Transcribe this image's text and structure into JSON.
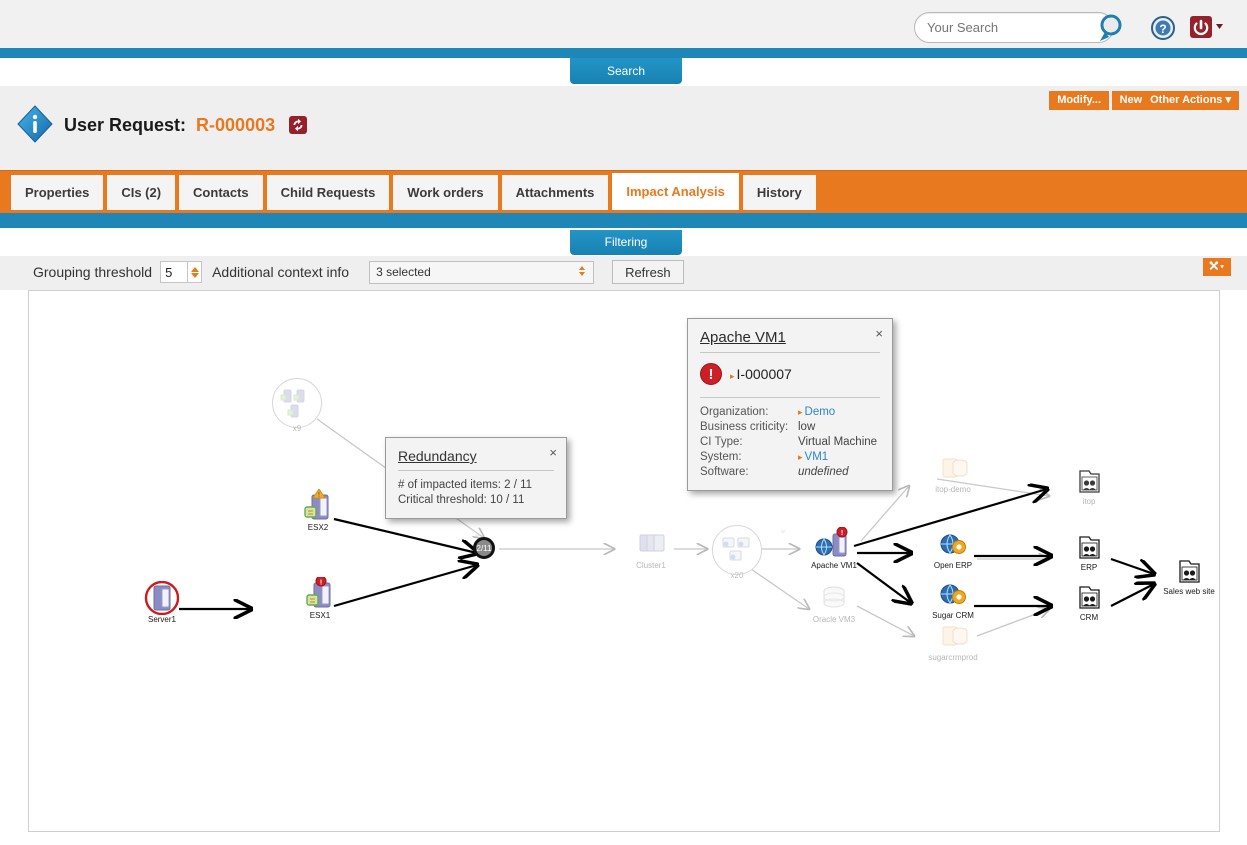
{
  "topbar": {
    "search_placeholder": "Your Search",
    "search_value": "",
    "search_icon": "magnifier-icon",
    "help_icon": "help-question-icon",
    "power_icon": "power-logout-icon"
  },
  "search_tab": {
    "label": "Search"
  },
  "actions": {
    "modify": "Modify...",
    "new": "New...",
    "other": "Other Actions"
  },
  "page": {
    "title_prefix": "User Request:",
    "title_code": "R-000003",
    "info_icon": "info-diamond-icon",
    "refresh_icon": "refresh-icon"
  },
  "tabs": [
    {
      "label": "Properties",
      "active": false
    },
    {
      "label": "CIs (2)",
      "active": false
    },
    {
      "label": "Contacts",
      "active": false
    },
    {
      "label": "Child Requests",
      "active": false
    },
    {
      "label": "Work orders",
      "active": false
    },
    {
      "label": "Attachments",
      "active": false
    },
    {
      "label": "Impact Analysis",
      "active": true
    },
    {
      "label": "History",
      "active": false
    }
  ],
  "filtering_tab": {
    "label": "Filtering"
  },
  "filters": {
    "grouping_label": "Grouping threshold",
    "grouping_value": "5",
    "context_label": "Additional context info",
    "context_value": "3 selected",
    "refresh_label": "Refresh",
    "tools_icon": "tools-wrench-icon"
  },
  "popups": {
    "apache": {
      "title": "Apache VM1",
      "close": "×",
      "ticket": "I-000007",
      "ticket_icon": "error-exclamation-icon",
      "fields": [
        {
          "key": "Organization:",
          "value": "Demo",
          "link": true
        },
        {
          "key": "Business criticity:",
          "value": "low",
          "link": false
        },
        {
          "key": "CI Type:",
          "value": "Virtual Machine",
          "link": false
        },
        {
          "key": "System:",
          "value": "VM1",
          "link": true
        },
        {
          "key": "Software:",
          "value": "undefined",
          "italic": true
        }
      ]
    },
    "redundancy": {
      "title": "Redundancy",
      "close": "×",
      "line1": "# of impacted items: 2 / 11",
      "line2": "Critical threshold: 10 / 11"
    }
  },
  "graph": {
    "redundancy_badge": "2/11",
    "nodes": [
      {
        "id": "server1",
        "label": "Server1",
        "type": "server-critical",
        "dim": false
      },
      {
        "id": "esx1",
        "label": "ESX1",
        "type": "esx-critical",
        "dim": false
      },
      {
        "id": "esx2",
        "label": "ESX2",
        "type": "esx-warning",
        "dim": false
      },
      {
        "id": "group-x9",
        "label": "x9",
        "type": "group",
        "dim": true
      },
      {
        "id": "cluster1",
        "label": "Cluster1",
        "type": "cluster",
        "dim": true
      },
      {
        "id": "group-x20",
        "label": "x20",
        "type": "group",
        "dim": true
      },
      {
        "id": "apachevm1",
        "label": "Apache VM1",
        "type": "vm-critical",
        "dim": false
      },
      {
        "id": "oraclevm3",
        "label": "Oracle VM3",
        "type": "database",
        "dim": true
      },
      {
        "id": "itopdemo",
        "label": "itop-demo",
        "type": "db-app",
        "dim": true
      },
      {
        "id": "openerp",
        "label": "Open ERP",
        "type": "app",
        "dim": false
      },
      {
        "id": "sugarcrm",
        "label": "Sugar CRM",
        "type": "app",
        "dim": false
      },
      {
        "id": "sugarcrmprod",
        "label": "sugarcrmprod",
        "type": "db-app",
        "dim": true
      },
      {
        "id": "itop",
        "label": "itop",
        "type": "business",
        "dim": true
      },
      {
        "id": "erp",
        "label": "ERP",
        "type": "business",
        "dim": false
      },
      {
        "id": "crm",
        "label": "CRM",
        "type": "business",
        "dim": false
      },
      {
        "id": "saleswebsite",
        "label": "Sales web site",
        "type": "business",
        "dim": false
      }
    ]
  }
}
